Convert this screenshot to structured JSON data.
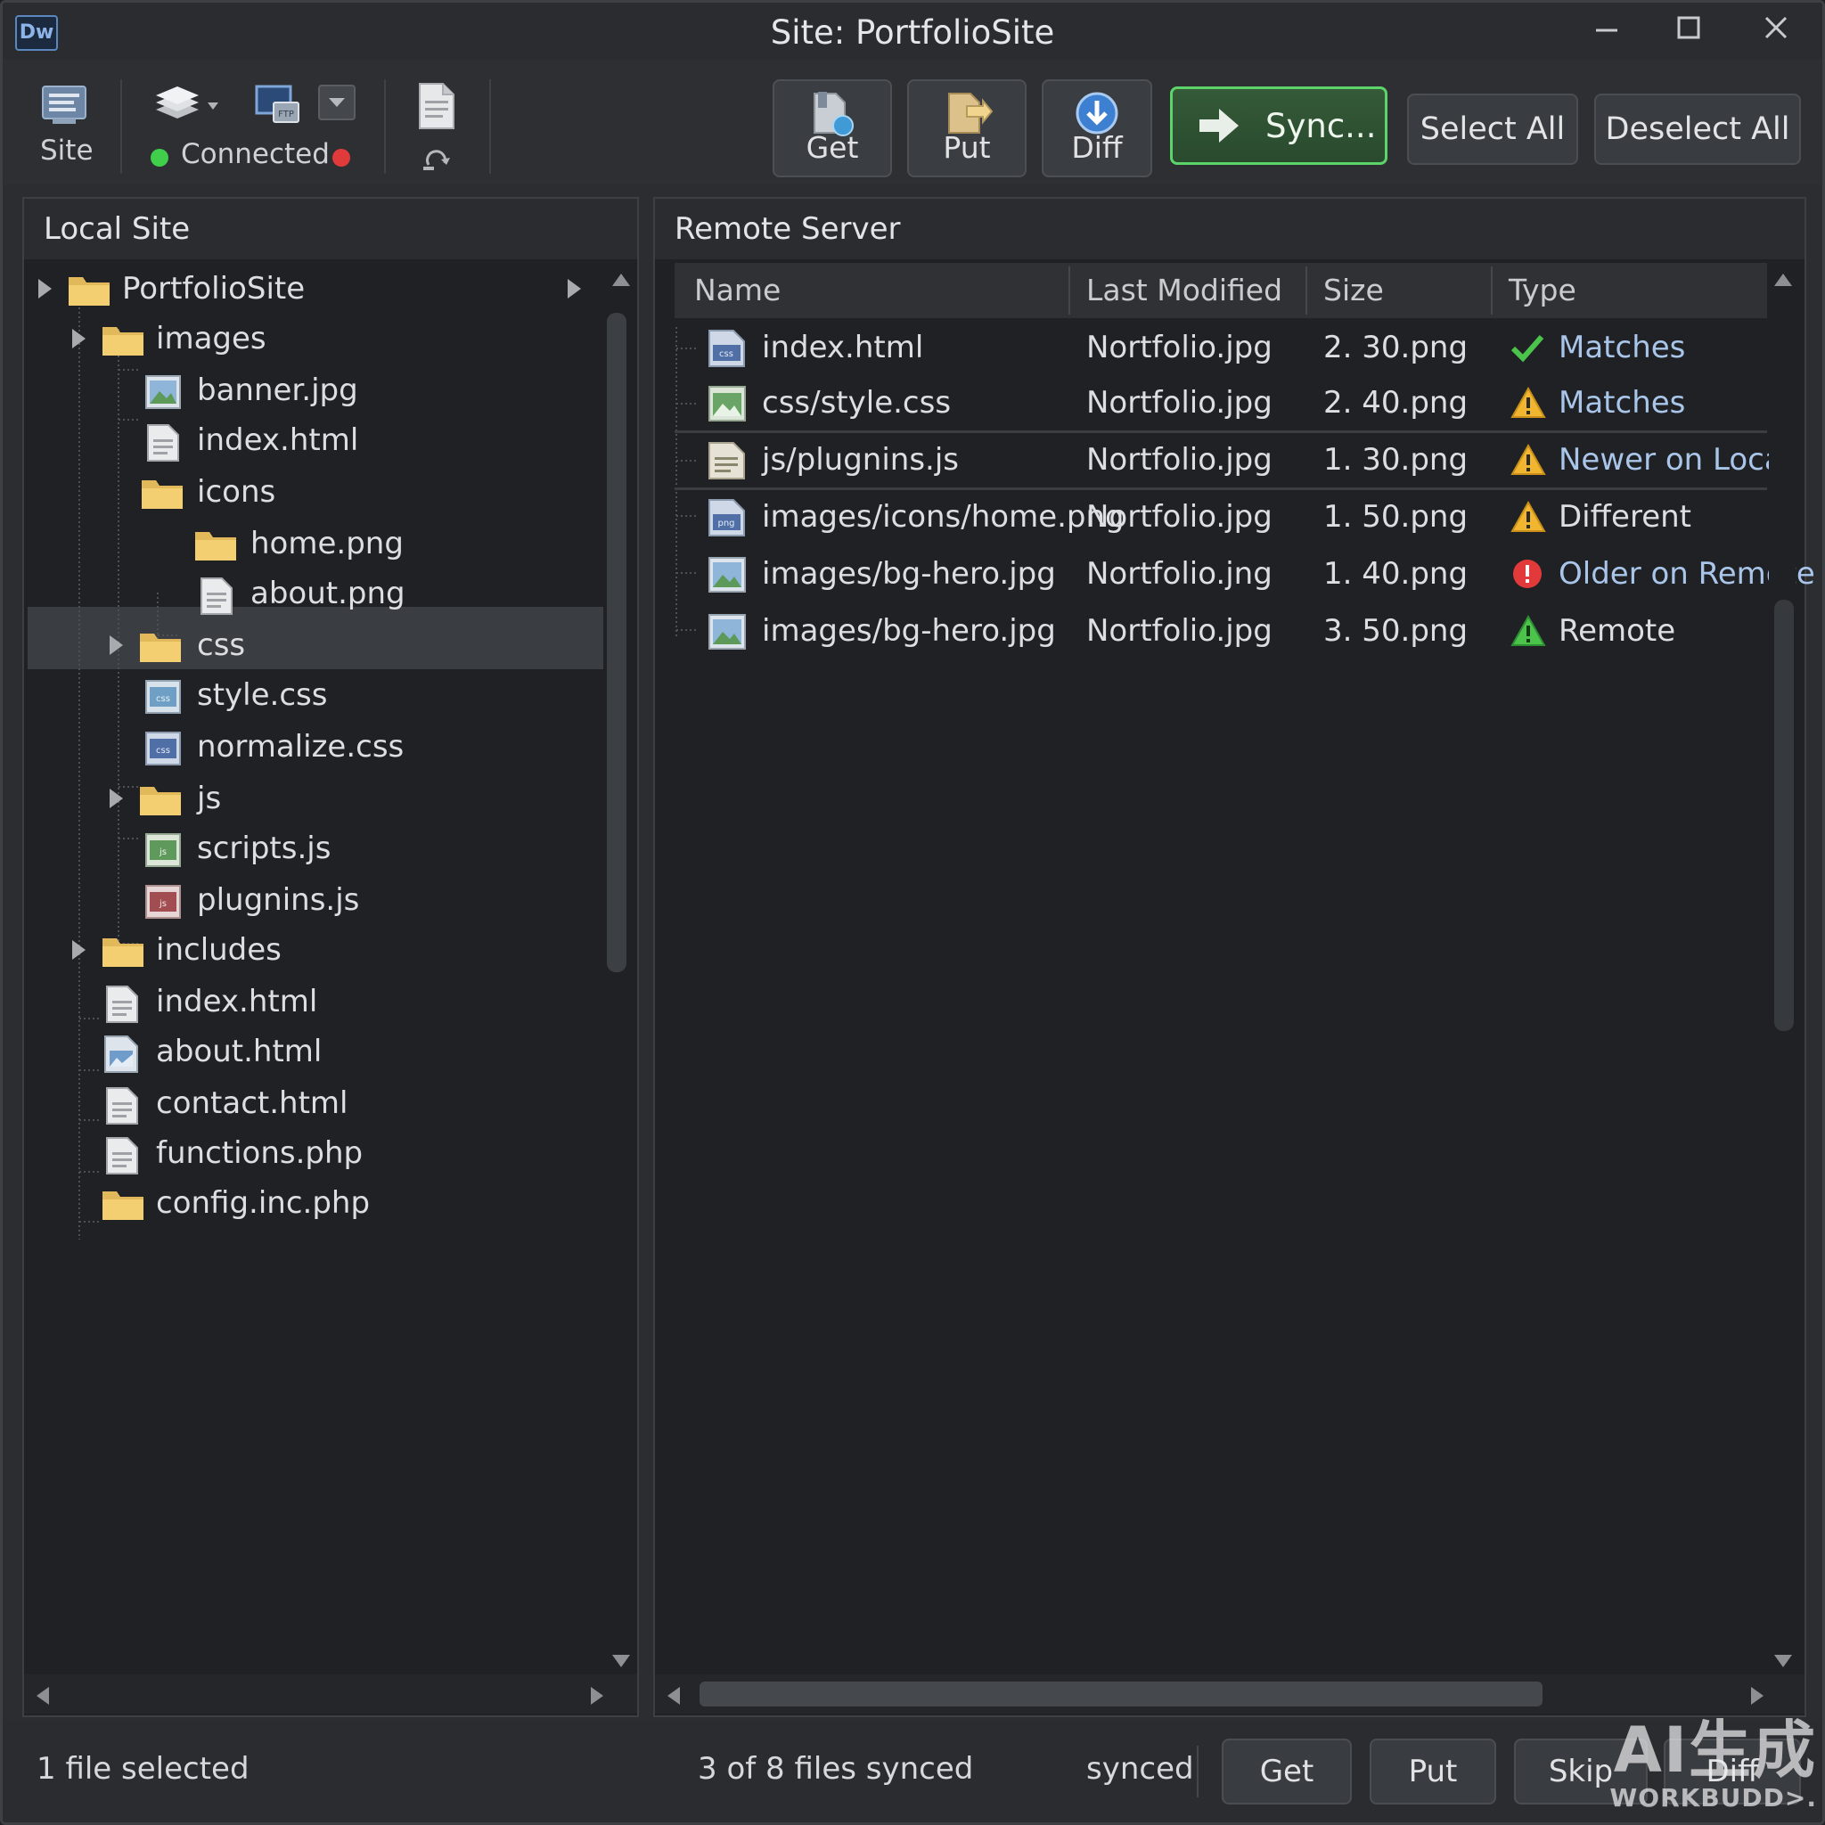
{
  "window": {
    "app_badge": "Dw",
    "title": "Site: PortfolioSite"
  },
  "toolbar": {
    "site_label": "Site",
    "connection_status": "Connected",
    "get_label": "Get",
    "put_label": "Put",
    "diff_label": "Diff",
    "sync_label": "Sync...",
    "select_all_label": "Select All",
    "deselect_all_label": "Deselect All"
  },
  "local_panel": {
    "title": "Local Site",
    "items": [
      {
        "label": "PortfolioSite",
        "kind": "folder"
      },
      {
        "label": "images",
        "kind": "folder"
      },
      {
        "label": "banner.jpg",
        "kind": "image"
      },
      {
        "label": "index.html",
        "kind": "doc",
        "selected": true
      },
      {
        "label": "icons",
        "kind": "folder"
      },
      {
        "label": "home.png",
        "kind": "folder"
      },
      {
        "label": "about.png",
        "kind": "doc"
      },
      {
        "label": "css",
        "kind": "folder"
      },
      {
        "label": "style.css",
        "kind": "css"
      },
      {
        "label": "normalize.css",
        "kind": "css"
      },
      {
        "label": "js",
        "kind": "folder"
      },
      {
        "label": "scripts.js",
        "kind": "js"
      },
      {
        "label": "plugnins.js",
        "kind": "js"
      },
      {
        "label": "includes",
        "kind": "folder"
      },
      {
        "label": "index.html",
        "kind": "doc"
      },
      {
        "label": "about.html",
        "kind": "image"
      },
      {
        "label": "contact.html",
        "kind": "doc"
      },
      {
        "label": "functions.php",
        "kind": "doc"
      },
      {
        "label": "config.inc.php",
        "kind": "folder"
      }
    ]
  },
  "remote_panel": {
    "title": "Remote Server",
    "columns": [
      "Name",
      "Last Modified",
      "Size",
      "Type"
    ],
    "rows": [
      {
        "name": "index.html",
        "modified": "Nortfolio.jpg",
        "size": "2. 30.png",
        "type": "Matches",
        "status_icon": "check-icon"
      },
      {
        "name": "css/style.css",
        "modified": "Nortfolio.jpg",
        "size": "2. 40.png",
        "type": "Matches",
        "status_icon": "warning-icon"
      },
      {
        "name": "js/plugnins.js",
        "modified": "Nortfolio.jpg",
        "size": "1. 30.png",
        "type": "Newer on Local",
        "status_icon": "warning-icon"
      },
      {
        "name": "images/icons/home.png",
        "modified": "Nortfolio.jpg",
        "size": "1. 50.png",
        "type": "Different",
        "status_icon": "warning-icon"
      },
      {
        "name": "images/bg-hero.jpg",
        "modified": "Nortfolio.jng",
        "size": "1. 40.png",
        "type": "Older on Remote",
        "status_icon": "error-icon"
      },
      {
        "name": "images/bg-hero.jpg",
        "modified": "Nortfolio.jpg",
        "size": "3. 50.png",
        "type": "Remote",
        "status_icon": "remote-warning-icon"
      }
    ]
  },
  "statusbar": {
    "selection": "1 file selected",
    "sync_progress": "3 of 8 files synced",
    "state": "synced",
    "get_label": "Get",
    "put_label": "Put",
    "skip_label": "Skip",
    "diff_label": "Diff"
  },
  "watermark": {
    "line1": "AI生成",
    "line2": "WORKBUDD>."
  },
  "colors": {
    "accent_green": "#5cd46a",
    "status_connected": "#3fcf4a",
    "status_disconnected": "#e03a3a",
    "warning": "#f0b630",
    "error": "#e23a3a",
    "check": "#4cc44c",
    "link_blue": "#a9c6ea"
  }
}
